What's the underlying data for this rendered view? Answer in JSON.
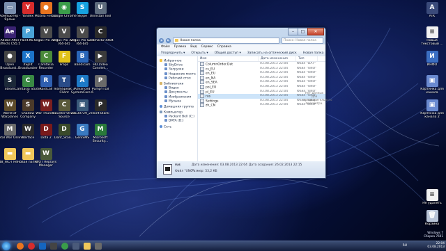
{
  "desktop_icons": [
    {
      "label": "Компьютер - Ярлык",
      "color": "#7b8fae",
      "glyph": "▭"
    },
    {
      "label": "Yandex",
      "color": "#d62c2c",
      "glyph": "Y"
    },
    {
      "label": "Mozilla Firefox",
      "color": "#e8741f",
      "glyph": "●"
    },
    {
      "label": "Google Chrome",
      "color": "#3a9c4a",
      "glyph": "◉"
    },
    {
      "label": "Skype",
      "color": "#16a2e0",
      "glyph": "S"
    },
    {
      "label": "Uninstall Tool",
      "color": "#5d6b7d",
      "glyph": "U"
    },
    {
      "label": "Adobe After Effects CS5.5",
      "color": "#3a2372",
      "glyph": "Ae"
    },
    {
      "label": "Paint.NET",
      "color": "#4aa3d8",
      "glyph": "P"
    },
    {
      "label": "Vegas Pro 10.0",
      "color": "#4b4b4b",
      "glyph": "V"
    },
    {
      "label": "Vegas Pro 12.0 (64-bit)",
      "color": "#4b4b4b",
      "glyph": "V"
    },
    {
      "label": "Vegas Pro 12.0 (64-bit)",
      "color": "#4b4b4b",
      "glyph": "V"
    },
    {
      "label": "CinemaHD 4484",
      "color": "#2a2a2a",
      "glyph": "C"
    },
    {
      "label": "Open Broadcast...",
      "color": "#444",
      "glyph": "●"
    },
    {
      "label": "XSplit Broadcaster",
      "color": "#1c74c9",
      "glyph": "X"
    },
    {
      "label": "Camtasia Recorder",
      "color": "#4a8a3a",
      "glyph": "C"
    },
    {
      "label": "Fraps",
      "color": "#e0c21a",
      "glyph": "F"
    },
    {
      "label": "Bandicam",
      "color": "#2a66b8",
      "glyph": "B"
    },
    {
      "label": "HD Video Convert...",
      "color": "#3b3b3b",
      "glyph": "▶"
    },
    {
      "label": "Steam",
      "color": "#1b2838",
      "glyph": "S"
    },
    {
      "label": "Camtasia Studio 7",
      "color": "#3a8a44",
      "glyph": "C"
    },
    {
      "label": "RaidCall",
      "color": "#2f5fb0",
      "glyph": "R"
    },
    {
      "label": "TeamSpeak 3 Client",
      "color": "#2a4c88",
      "glyph": "T"
    },
    {
      "label": "Advanced SystemCare 6",
      "color": "#1d7ac7",
      "glyph": "A"
    },
    {
      "label": "PumpYT18",
      "color": "#6a6a6a",
      "glyph": "P"
    },
    {
      "label": "World of Warplanes",
      "color": "#5b4a2a",
      "glyph": "W"
    },
    {
      "label": "Shadow Company",
      "color": "#4a3a2a",
      "glyph": "S"
    },
    {
      "label": "War Thunder",
      "color": "#7a1f1f",
      "glyph": "W"
    },
    {
      "label": "Counter-Strike Source",
      "color": "#5a5a3a",
      "glyph": "C"
    },
    {
      "label": "20130729_2...",
      "color": "#3a5a7a",
      "glyph": "▣"
    },
    {
      "label": "Point Blank",
      "color": "#2a2a2a",
      "glyph": "P"
    },
    {
      "label": "Metal War Online",
      "color": "#6a6a6a",
      "glyph": "M"
    },
    {
      "label": "Warface",
      "color": "#2a2a2a",
      "glyph": "W"
    },
    {
      "label": "Dota 2",
      "color": "#7a1a1a",
      "glyph": "D"
    },
    {
      "label": "Dont_Stan...",
      "color": "#3a4a2a",
      "glyph": "D"
    },
    {
      "label": "GeniSMS",
      "color": "#3a7ac0",
      "glyph": "G"
    },
    {
      "label": "Microsoft Security...",
      "color": "#2a7a3a",
      "glyph": "M"
    },
    {
      "label": "48_WOT Re...",
      "color": "#f0c75a",
      "glyph": "▬"
    },
    {
      "label": "Новая папка",
      "color": "#f0c75a",
      "glyph": "▬"
    },
    {
      "label": "WOT Replays Manager",
      "color": "#4a5a3a",
      "glyph": "W"
    }
  ],
  "right_icons": [
    {
      "label": "ATK",
      "color": "#3a4a7a",
      "glyph": "A"
    },
    {
      "label": "Новый текстовый ...",
      "color": "#f2f2f2",
      "glyph": "≡"
    },
    {
      "label": "ИНФО",
      "color": "#3b6ec2",
      "glyph": "И"
    },
    {
      "label": "Картинка для канала",
      "color": "#6a8ad0",
      "glyph": "▣"
    },
    {
      "label": "Картинка для канала 2",
      "color": "#6a8ad0",
      "glyph": "▣"
    },
    {
      "label": "Не удалять",
      "color": "#f2f2f2",
      "glyph": "≡"
    },
    {
      "label": "Корзина",
      "color": "#b8c4d8",
      "glyph": "🗑"
    }
  ],
  "window": {
    "address": "Новая папка",
    "search_placeholder": "Поиск: Новая папка",
    "menu": [
      "Файл",
      "Правка",
      "Вид",
      "Сервис",
      "Справка"
    ],
    "toolbar": [
      "Упорядочить ▾",
      "Открыть ▾",
      "Общий доступ ▾",
      "Записать на оптический диск",
      "Новая папка"
    ],
    "nav": {
      "favorites_header": "Избранное",
      "favorites": [
        "SkyDrive",
        "Загрузки",
        "Недавние места",
        "Рабочий стол"
      ],
      "libraries_header": "Библиотеки",
      "libraries": [
        "Видео",
        "Документы",
        "Изображения",
        "Музыка"
      ],
      "homegroup": "Домашняя группа",
      "computer_header": "Компьютер",
      "drives": [
        "Packard Bell (C:)",
        "DATA (D:)"
      ],
      "network": "Сеть"
    },
    "columns": [
      "Имя",
      "Дата изменения",
      "Тип"
    ],
    "files": [
      {
        "name": "ColumnOrder.Dat",
        "date": "03.08.2013 22:04",
        "type": "Файл \"DAT\""
      },
      {
        "name": "cs_EU",
        "date": "03.08.2013 22:04",
        "type": "Файл \"UNO\""
      },
      {
        "name": "en_EU",
        "date": "03.08.2013 22:04",
        "type": "Файл \"UNO\""
      },
      {
        "name": "en_NA",
        "date": "03.08.2013 22:04",
        "type": "Файл \"UNO\""
      },
      {
        "name": "en_SEA",
        "date": "03.08.2013 22:04",
        "type": "Файл \"UNO\""
      },
      {
        "name": "pol_EU",
        "date": "03.08.2013 22:04",
        "type": "Файл \"UNO\""
      },
      {
        "name": "pl_EU",
        "date": "03.08.2013 22:04",
        "type": "Файл \"UNO\""
      },
      {
        "name": "rus",
        "date": "03.08.2013 22:04",
        "type": "Файл \"UNO\""
      },
      {
        "name": "Settings",
        "date": "03.08.2013 22:04",
        "type": "Файл \"UNO\""
      },
      {
        "name": "zh_CN",
        "date": "03.08.2013 22:04",
        "type": "Файл \"UNO\""
      }
    ],
    "preview_text": "Нет данных для предварительного просмотра.",
    "details": {
      "name": "rus",
      "date_line": "Дата изменения: 03.08.2013 22:04",
      "created_line": "Дата создания: 26.02.2013 22:15",
      "type_line": "Файл \"UNO\"",
      "size_line": "Размер: 53,2 КБ"
    }
  },
  "taskbar": {
    "lang": "RU",
    "time": "22:04",
    "date": "03.08.2013"
  },
  "watermark": {
    "line1": "Windows 7",
    "line2": "Сборка 7601"
  }
}
